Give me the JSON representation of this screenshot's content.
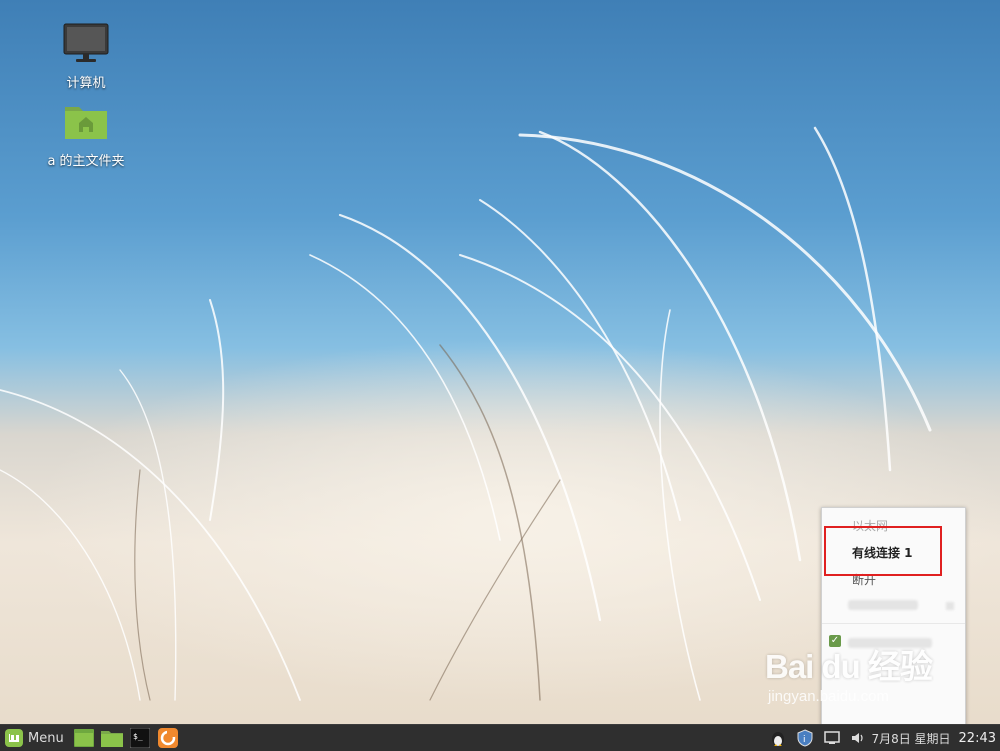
{
  "desktop": {
    "icons": [
      {
        "label": "计算机",
        "icon": "computer-monitor-icon"
      },
      {
        "label": "a 的主文件夹",
        "icon": "home-folder-icon"
      }
    ]
  },
  "network_menu": {
    "section_header": "以太网",
    "connection": "有线连接 1",
    "disconnect": "断开"
  },
  "taskbar": {
    "menu_label": "Menu",
    "launchers": [
      "show-desktop-icon",
      "files-icon",
      "terminal-icon",
      "firefox-icon"
    ],
    "tray_icons": [
      "linux-tux-icon",
      "shield-update-icon",
      "network-icon",
      "volume-icon"
    ],
    "date": "7月8日 星期日",
    "time": "22:43"
  },
  "watermark": {
    "main": "Bai du 经验",
    "sub": "jingyan.baidu.com"
  },
  "colors": {
    "taskbar_bg": "#2f2f2f",
    "mint_green": "#8bc34a",
    "highlight_red": "#e02020"
  }
}
